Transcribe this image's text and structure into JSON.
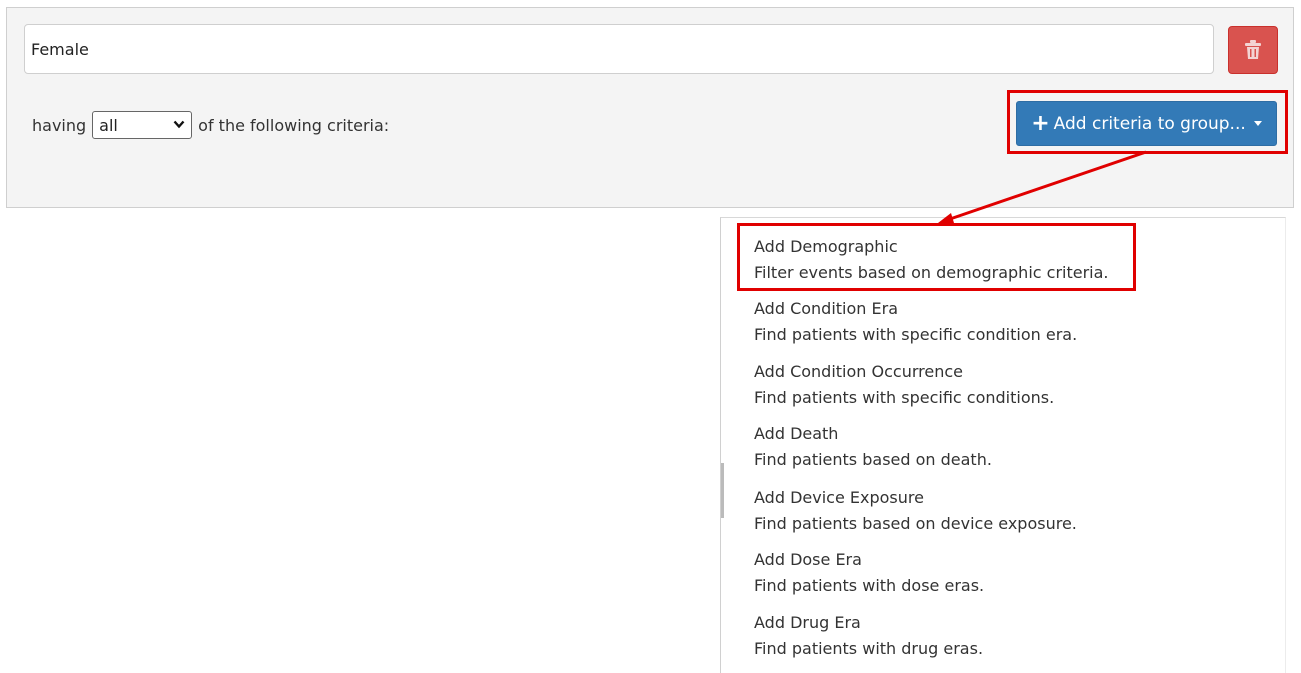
{
  "group": {
    "name_value": "Female",
    "having_prefix": "having",
    "match_options": [
      "all"
    ],
    "match_selected": "all",
    "having_suffix": "of the following criteria:",
    "add_button_label": "Add criteria to group...",
    "delete_button_color": "#d9534f",
    "add_button_color": "#337ab7"
  },
  "annotation_color": "#e00000",
  "menu": {
    "items": [
      {
        "title": "Add Demographic",
        "desc": "Filter events based on demographic criteria."
      },
      {
        "title": "Add Condition Era",
        "desc": "Find patients with specific condition era."
      },
      {
        "title": "Add Condition Occurrence",
        "desc": "Find patients with specific conditions."
      },
      {
        "title": "Add Death",
        "desc": "Find patients based on death."
      },
      {
        "title": "Add Device Exposure",
        "desc": "Find patients based on device exposure."
      },
      {
        "title": "Add Dose Era",
        "desc": "Find patients with dose eras."
      },
      {
        "title": "Add Drug Era",
        "desc": "Find patients with drug eras."
      }
    ]
  }
}
